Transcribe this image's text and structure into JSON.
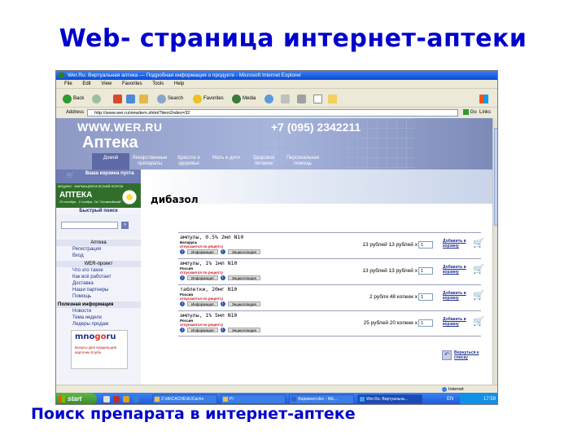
{
  "slide": {
    "title": "Web- страница интернет-аптеки",
    "caption": "Поиск препарата в интернет-аптеке"
  },
  "browser": {
    "window_title": "Wer.Ru: Виртуальная аптека — Подробная информация о продукте - Microsoft Internet Explorer",
    "menu": [
      "File",
      "Edit",
      "View",
      "Favorites",
      "Tools",
      "Help"
    ],
    "toolbar": {
      "back": "Back",
      "search": "Search",
      "favorites": "Favorites",
      "media": "Media"
    },
    "address_label": "Address",
    "address_value": "http://www.wer.ru/viewitem.shtml?item2ndex=32",
    "go_label": "Go",
    "links_label": "Links",
    "status_text": "",
    "status_zone": "Internet"
  },
  "site": {
    "url": "WWW.WER.RU",
    "phone": "+7  (095)  2342211",
    "logo": "Аптека",
    "nav": [
      {
        "label": "Домой",
        "active": true
      },
      {
        "label": "Лекарственные препараты",
        "active": false
      },
      {
        "label": "Красота и здоровье",
        "active": false
      },
      {
        "label": "Мать и дитя",
        "active": false
      },
      {
        "label": "Здоровое питание",
        "active": false
      },
      {
        "label": "Персональная помощь",
        "active": false
      }
    ],
    "cart_text": "Ваша корзина пуста",
    "promo": {
      "top": "МЕДИКО · ФАРМАЦЕВТИЧЕСКИЙ ФОРУМ",
      "brand": "АПТЕКА",
      "sub": "29 октября - 2 ноября. Ок \"Олимпийский\""
    },
    "quick_search_label": "Быстрый поиск",
    "search_go": "»",
    "sections": {
      "apteka": "Аптека",
      "wer_project": "WER-проект",
      "useful": "Полезная информация"
    },
    "apteka_links": [
      "Регистрация",
      "Вход"
    ],
    "wer_links": [
      "Что это такое",
      "Как всё работает",
      "Доставка",
      "Наши партнеры",
      "Помощь"
    ],
    "useful_links": [
      "Новости",
      "Тема недели",
      "Лидеры продаж"
    ],
    "mnogo": {
      "logo_a": "mno",
      "logo_b": "go",
      "logo_c": "ru",
      "text": "Бонусы Для владельцев карточек Клуба"
    },
    "product_title": "дибазол",
    "products": [
      {
        "name": "ампулы, 0.5% 2мл N10",
        "country": "Беларусь",
        "rx": "отпускается по рецепту",
        "info": "Информация",
        "encyclopedia": "Энциклопедия",
        "price": "13 рублей 13 рублей x",
        "qty": "1",
        "add": "Добавить в корзину"
      },
      {
        "name": "ампулы, 1% 1мл N10",
        "country": "Россия",
        "rx": "отпускается по рецепту",
        "info": "Информация",
        "encyclopedia": "Энциклопедия",
        "price": "13 рублей 13 рублей x",
        "qty": "1",
        "add": "Добавить в корзину"
      },
      {
        "name": "таблетки, 20мг N10",
        "country": "Россия",
        "rx": "отпускается по рецепту",
        "info": "Информация",
        "encyclopedia": "Энциклопедия",
        "price": "2 рубля 48 копеек x",
        "qty": "1",
        "add": "Добавить в корзину"
      },
      {
        "name": "ампулы, 1% 5мл N10",
        "country": "Россия",
        "rx": "отпускается по рецепту",
        "info": "Информация",
        "encyclopedia": "Энциклопедия",
        "price": "25 рублей 20 копеек x",
        "qty": "1",
        "add": "Добавить в корзину"
      }
    ],
    "back_label": "Вернуться к списку"
  },
  "taskbar": {
    "start": "start",
    "tasks": [
      {
        "label": "Z:\\db\\CACHE\\tiUCache",
        "active": false
      },
      {
        "label": "PI",
        "active": false
      },
      {
        "label": "Фарминет.doc - Mic...",
        "active": false
      },
      {
        "label": "Wer.Ru: Виртуальна...",
        "active": true
      }
    ],
    "lang": "EN",
    "clock": "17:59"
  }
}
